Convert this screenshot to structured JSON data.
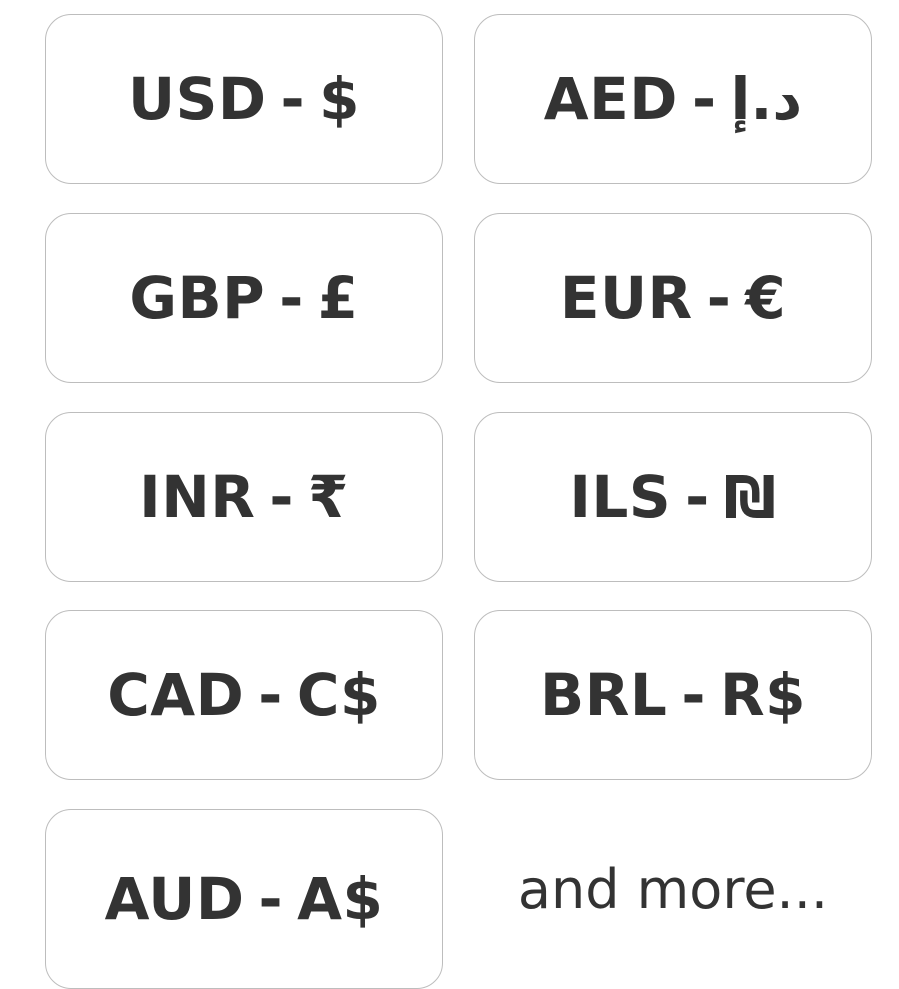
{
  "currencies": [
    {
      "code": "USD",
      "separator": "-",
      "symbol": "$"
    },
    {
      "code": "AED",
      "separator": "-",
      "symbol": "د.إ"
    },
    {
      "code": "GBP",
      "separator": "-",
      "symbol": "£"
    },
    {
      "code": "EUR",
      "separator": "-",
      "symbol": "€"
    },
    {
      "code": "INR",
      "separator": "-",
      "symbol": "₹"
    },
    {
      "code": "ILS",
      "separator": "-",
      "symbol": "₪"
    },
    {
      "code": "CAD",
      "separator": "-",
      "symbol": "C$"
    },
    {
      "code": "BRL",
      "separator": "-",
      "symbol": "R$"
    },
    {
      "code": "AUD",
      "separator": "-",
      "symbol": "A$"
    }
  ],
  "more_text": "and more...",
  "colors": {
    "text": "#333333",
    "card_border": "#bdbdbd",
    "background": "#ffffff"
  }
}
